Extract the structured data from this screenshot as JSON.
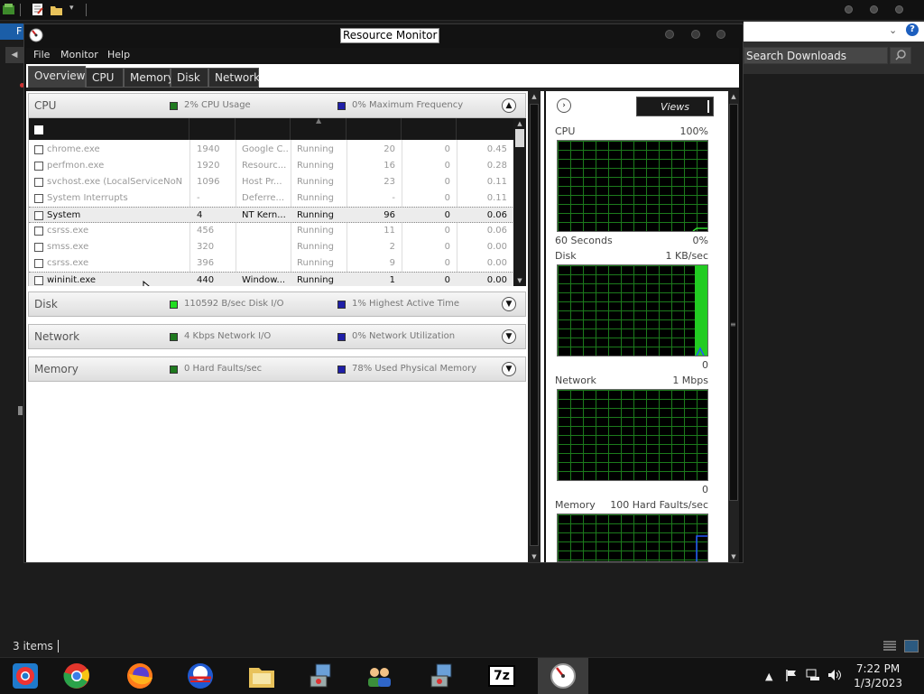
{
  "window": {
    "title": "Resource Monitor"
  },
  "menu": [
    "File",
    "Monitor",
    "Help"
  ],
  "tabs": [
    "Overview",
    "CPU",
    "Memory",
    "Disk",
    "Network"
  ],
  "explorer": {
    "search_placeholder": "Search Downloads",
    "status_items": "3 items",
    "left_tab_label": "F"
  },
  "cpu_section": {
    "title": "CPU",
    "stat1": "2% CPU Usage",
    "stat1_color": "#1f7a1f",
    "stat2": "0% Maximum Frequency",
    "stat2_color": "#1f1fa8",
    "rows": [
      {
        "image": "chrome.exe",
        "pid": "1940",
        "description": "Google C...",
        "status": "Running",
        "threads": "20",
        "cpu": "0",
        "avg_cpu": "0.45",
        "highlighted": false
      },
      {
        "image": "perfmon.exe",
        "pid": "1920",
        "description": "Resourc...",
        "status": "Running",
        "threads": "16",
        "cpu": "0",
        "avg_cpu": "0.28",
        "highlighted": false
      },
      {
        "image": "svchost.exe (LocalServiceNoNe...",
        "pid": "1096",
        "description": "Host Pr...",
        "status": "Running",
        "threads": "23",
        "cpu": "0",
        "avg_cpu": "0.11",
        "highlighted": false
      },
      {
        "image": "System Interrupts",
        "pid": "-",
        "description": "Deferre...",
        "status": "Running",
        "threads": "-",
        "cpu": "0",
        "avg_cpu": "0.11",
        "highlighted": false
      },
      {
        "image": "System",
        "pid": "4",
        "description": "NT Kern...",
        "status": "Running",
        "threads": "96",
        "cpu": "0",
        "avg_cpu": "0.06",
        "highlighted": true
      },
      {
        "image": "csrss.exe",
        "pid": "456",
        "description": "",
        "status": "Running",
        "threads": "11",
        "cpu": "0",
        "avg_cpu": "0.06",
        "highlighted": false
      },
      {
        "image": "smss.exe",
        "pid": "320",
        "description": "",
        "status": "Running",
        "threads": "2",
        "cpu": "0",
        "avg_cpu": "0.00",
        "highlighted": false
      },
      {
        "image": "csrss.exe",
        "pid": "396",
        "description": "",
        "status": "Running",
        "threads": "9",
        "cpu": "0",
        "avg_cpu": "0.00",
        "highlighted": false
      },
      {
        "image": "wininit.exe",
        "pid": "440",
        "description": "Window...",
        "status": "Running",
        "threads": "1",
        "cpu": "0",
        "avg_cpu": "0.00",
        "highlighted": true
      }
    ]
  },
  "disk_section": {
    "title": "Disk",
    "stat1": "110592 B/sec Disk I/O",
    "stat1_color": "#22dd22",
    "stat2": "1% Highest Active Time",
    "stat2_color": "#1f1fa8"
  },
  "network_section": {
    "title": "Network",
    "stat1": "4 Kbps Network I/O",
    "stat1_color": "#1f7a1f",
    "stat2": "0% Network Utilization",
    "stat2_color": "#1f1fa8"
  },
  "memory_section": {
    "title": "Memory",
    "stat1": "0 Hard Faults/sec",
    "stat1_color": "#1f7a1f",
    "stat2": "78% Used Physical Memory",
    "stat2_color": "#1f1fa8"
  },
  "right_pane": {
    "views_label": "Views",
    "graphs": [
      {
        "title": "CPU",
        "max_label": "100%",
        "bottom_left": "60 Seconds",
        "bottom_right": "0%"
      },
      {
        "title": "Disk",
        "max_label": "1 KB/sec",
        "bottom_left": "",
        "bottom_right": "0"
      },
      {
        "title": "Network",
        "max_label": "1 Mbps",
        "bottom_left": "",
        "bottom_right": "0"
      },
      {
        "title": "Memory",
        "max_label": "100 Hard Faults/sec",
        "bottom_left": "",
        "bottom_right": ""
      }
    ]
  },
  "taskbar": {
    "apps": [
      "chrome-icon",
      "firefox-icon",
      "obama-logo-icon",
      "file-explorer-icon",
      "installer-icon",
      "users-icon",
      "installer-icon",
      "7zip-icon",
      "resource-monitor-icon"
    ],
    "sevenzip_label": "7z",
    "clock_time": "7:22 PM",
    "clock_date": "1/3/2023"
  }
}
